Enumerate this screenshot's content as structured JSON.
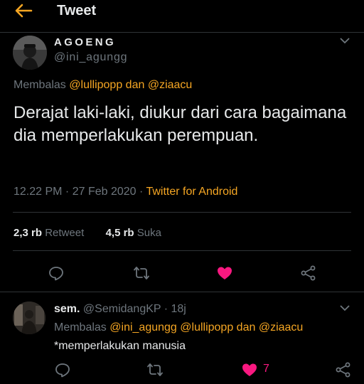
{
  "header": {
    "title": "Tweet"
  },
  "tweet": {
    "display_name": "AGOENG",
    "handle": "@ini_agungg",
    "replying_prefix": "Membalas",
    "reply_to_1": "@lullipopp",
    "reply_join": "dan",
    "reply_to_2": "@ziaacu",
    "text": "Derajat laki-laki, diukur dari cara bagaimana dia memperlakukan perempuan.",
    "time": "12.22 PM · 27 Feb 2020 ·",
    "source": "Twitter for Android",
    "retweet_count": "2,3 rb",
    "retweet_label": "Retweet",
    "like_count": "4,5 rb",
    "like_label": "Suka"
  },
  "reply": {
    "display_name": "sem.",
    "handle": "@SemidangKP",
    "time_sep": "·",
    "time": "18j",
    "replying_prefix": "Membalas",
    "reply_to_1": "@ini_agungg",
    "reply_to_2": "@lullipopp",
    "reply_join": "dan",
    "reply_to_3": "@ziaacu",
    "text": "*memperlakukan manusia",
    "like_count": "7"
  },
  "colors": {
    "accent": "#f5a623",
    "like": "#f91880",
    "muted": "#6e767d",
    "background": "#000000"
  },
  "icons": [
    "back-arrow-icon",
    "chevron-down-icon",
    "reply-icon",
    "retweet-icon",
    "heart-icon",
    "share-icon"
  ]
}
